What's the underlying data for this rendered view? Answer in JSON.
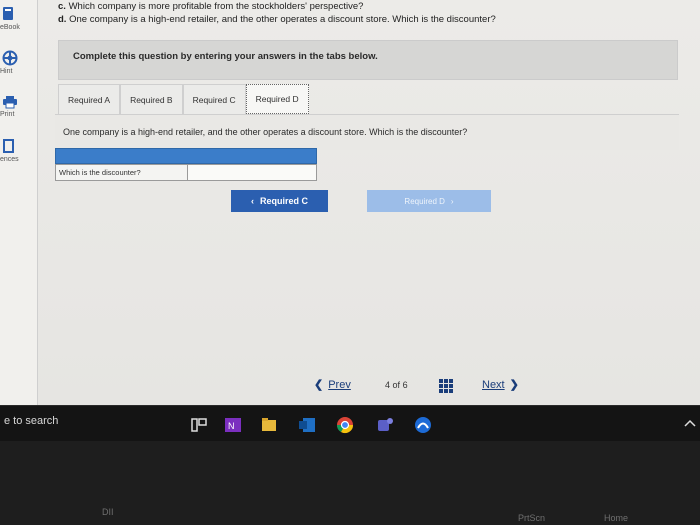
{
  "sidebar": {
    "items": [
      {
        "label": "eBook",
        "icon": "book-icon"
      },
      {
        "label": "Hint",
        "icon": "hint-icon"
      },
      {
        "label": "Print",
        "icon": "print-icon"
      },
      {
        "label": "ences",
        "icon": "references-icon"
      }
    ]
  },
  "questions": {
    "c_prefix": "c.",
    "c_text": "Which company is more profitable from the stockholders' perspective?",
    "d_prefix": "d.",
    "d_text": "One company is a high-end retailer, and the other operates a discount store. Which is the discounter?"
  },
  "instruction": "Complete this question by entering your answers in the tabs below.",
  "tabs": [
    {
      "label": "Required A"
    },
    {
      "label": "Required B"
    },
    {
      "label": "Required C"
    },
    {
      "label": "Required D",
      "active": true
    }
  ],
  "tab_content": {
    "question": "One company is a high-end retailer, and the other operates a discount store. Which is the discounter?"
  },
  "answer": {
    "label": "Which is the discounter?",
    "value": ""
  },
  "nav_buttons": {
    "prev_label": "Required C",
    "next_label": "Required D"
  },
  "pager": {
    "prev": "Prev",
    "current": "4",
    "of": "of",
    "total": "6",
    "next": "Next"
  },
  "taskbar": {
    "search_text": "e to search"
  },
  "keyboard": {
    "keys": [
      "DII",
      "PrtScn",
      "Home"
    ]
  },
  "colors": {
    "primary_button": "#2b5fb0",
    "disabled_button": "#9cbde8",
    "answer_header": "#3b7dc9"
  }
}
